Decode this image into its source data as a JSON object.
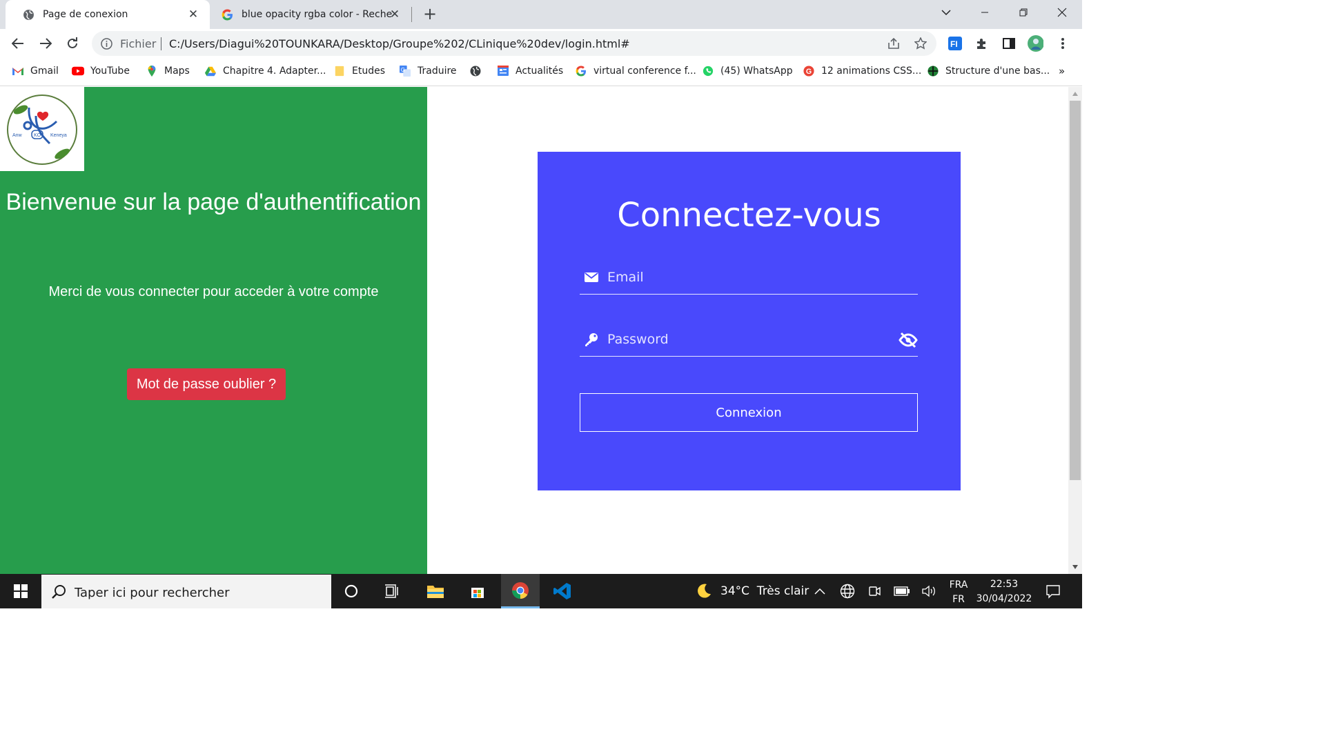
{
  "browser": {
    "tabs": [
      {
        "title": "Page de conexion",
        "active": true
      },
      {
        "title": "blue opacity rgba color - Recherc",
        "active": false
      }
    ],
    "address": {
      "scheme_label": "Fichier",
      "url": "C:/Users/Diagui%20TOUNKARA/Desktop/Groupe%202/CLinique%20dev/login.html#"
    },
    "bookmarks": [
      {
        "label": "Gmail",
        "icon": "gmail-icon"
      },
      {
        "label": "YouTube",
        "icon": "youtube-icon"
      },
      {
        "label": "Maps",
        "icon": "maps-icon"
      },
      {
        "label": "Chapitre 4. Adapter...",
        "icon": "drive-icon"
      },
      {
        "label": "Etudes",
        "icon": "folder-icon"
      },
      {
        "label": "Traduire",
        "icon": "translate-icon"
      },
      {
        "label": "",
        "icon": "globe-icon"
      },
      {
        "label": "Actualités",
        "icon": "news-icon"
      },
      {
        "label": "virtual conference f...",
        "icon": "google-icon"
      },
      {
        "label": "(45) WhatsApp",
        "icon": "whatsapp-icon"
      },
      {
        "label": "12 animations CSS...",
        "icon": "g-red-icon"
      },
      {
        "label": "Structure d'une bas...",
        "icon": "green-globe-icon"
      }
    ],
    "overflow_label": "»"
  },
  "page": {
    "logo": {
      "left_text": "Anw",
      "center_text": "KO",
      "right_text": "Keneya"
    },
    "welcome_title": "Bienvenue sur la page d'authentification",
    "welcome_sub": "Merci de vous connecter pour acceder à votre compte",
    "forgot_button": "Mot de passe oublier ?",
    "login": {
      "title": "Connectez-vous",
      "email_placeholder": "Email",
      "password_placeholder": "Password",
      "submit": "Connexion"
    }
  },
  "colors": {
    "left_panel": "#279d4c",
    "card": "#4949fc",
    "danger": "#dc3545"
  },
  "taskbar": {
    "search_placeholder": "Taper ici pour rechercher",
    "weather": "34°C  Très clair",
    "lang_top": "FRA",
    "lang_bottom": "FR",
    "time": "22:53",
    "date": "30/04/2022"
  }
}
